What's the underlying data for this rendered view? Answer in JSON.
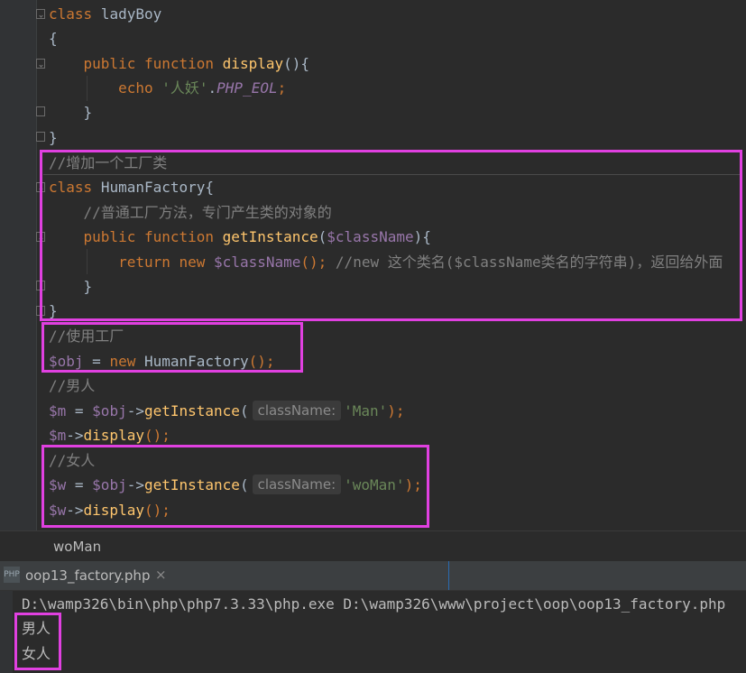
{
  "editor": {
    "code": {
      "l1_kw": "class",
      "l1_name": "ladyBoy",
      "l2": "{",
      "l3_kw1": "public",
      "l3_kw2": "function",
      "l3_fn": "display",
      "l3_rest": "(){",
      "l4_kw": "echo",
      "l4_str": "'人妖'",
      "l4_dot": ".",
      "l4_const": "PHP_EOL",
      "l4_semi": ";",
      "l5": "}",
      "l6": "}",
      "l7_comment": "//增加一个工厂类",
      "l8_kw": "class",
      "l8_name": "HumanFactory{",
      "l9_comment": "//普通工厂方法，专门产生类的对象的",
      "l10_kw1": "public",
      "l10_kw2": "function",
      "l10_fn": "getInstance",
      "l10_p1": "(",
      "l10_var": "$className",
      "l10_p2": "){",
      "l11_kw1": "return",
      "l11_kw2": "new",
      "l11_var": "$className",
      "l11_p": "();",
      "l11_comment": "//new 这个类名($className类名的字符串)，返回给外面",
      "l12": "}",
      "l13": "}",
      "l14_comment": "//使用工厂",
      "l15_var": "$obj",
      "l15_eq": " = ",
      "l15_kw": "new",
      "l15_cls": "HumanFactory",
      "l15_p": "();",
      "l16_comment": "//男人",
      "l17_var1": "$m",
      "l17_eq": " = ",
      "l17_var2": "$obj",
      "l17_arrow": "->",
      "l17_fn": "getInstance",
      "l17_p1": "(",
      "l17_hint": "className:",
      "l17_str": "'Man'",
      "l17_p2": ");",
      "l18_var": "$m",
      "l18_arrow": "->",
      "l18_fn": "display",
      "l18_p": "();",
      "l19_comment": "//女人",
      "l20_var1": "$w",
      "l20_eq": " = ",
      "l20_var2": "$obj",
      "l20_arrow": "->",
      "l20_fn": "getInstance",
      "l20_p1": "(",
      "l20_hint": "className:",
      "l20_str": "'woMan'",
      "l20_p2": ");",
      "l21_var": "$w",
      "l21_arrow": "->",
      "l21_fn": "display",
      "l21_p": "();"
    }
  },
  "breadcrumb": "woMan",
  "run_panel": {
    "tab_label": "oop13_factory.php",
    "tab_icon_text": "PHP",
    "close_glyph": "×",
    "command": "D:\\wamp326\\bin\\php\\php7.3.33\\php.exe D:\\wamp326\\www\\project\\oop\\oop13_factory.php",
    "output": [
      "男人",
      "女人"
    ]
  },
  "colors": {
    "highlight": "#e040e0",
    "keyword": "#cc7832",
    "function": "#ffc66d",
    "variable": "#9876aa",
    "string": "#6a8759",
    "comment": "#808080"
  }
}
